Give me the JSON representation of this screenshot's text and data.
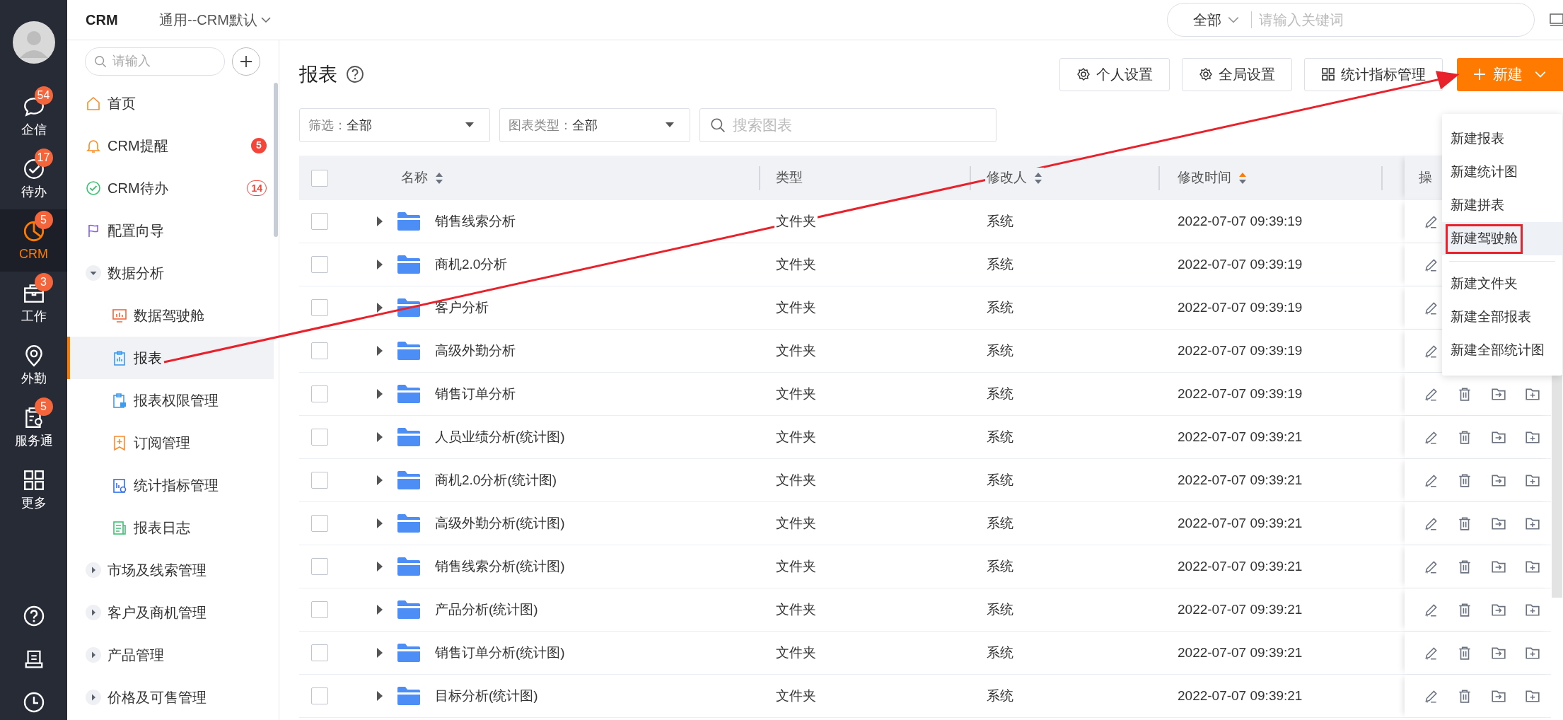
{
  "rail": {
    "items": [
      {
        "label": "企信",
        "badge": "54",
        "selected": false
      },
      {
        "label": "待办",
        "badge": "17",
        "selected": false
      },
      {
        "label": "CRM",
        "badge": "5",
        "selected": true
      },
      {
        "label": "工作",
        "badge": "3",
        "selected": false
      },
      {
        "label": "外勤",
        "selected": false
      },
      {
        "label": "服务通",
        "badge": "5",
        "selected": false
      },
      {
        "label": "更多",
        "selected": false
      }
    ]
  },
  "topbar": {
    "app": "CRM",
    "view": "通用--CRM默认",
    "scope": "全部",
    "search_placeholder": "请输入关键词"
  },
  "sidebar": {
    "search_placeholder": "请输入",
    "items": [
      {
        "label": "首页",
        "selected": false
      },
      {
        "label": "CRM提醒",
        "badge": "5",
        "outlined": false,
        "selected": false
      },
      {
        "label": "CRM待办",
        "badge": "14",
        "outlined": true,
        "selected": false
      },
      {
        "label": "配置向导",
        "selected": false
      },
      {
        "label": "数据分析",
        "expanded": true,
        "selected": false,
        "children": [
          {
            "label": "数据驾驶舱",
            "selected": false
          },
          {
            "label": "报表",
            "selected": true
          },
          {
            "label": "报表权限管理",
            "selected": false
          },
          {
            "label": "订阅管理",
            "selected": false
          },
          {
            "label": "统计指标管理",
            "selected": false
          },
          {
            "label": "报表日志",
            "selected": false
          }
        ]
      },
      {
        "label": "市场及线索管理",
        "expanded": false,
        "selected": false
      },
      {
        "label": "客户及商机管理",
        "expanded": false,
        "selected": false
      },
      {
        "label": "产品管理",
        "expanded": false,
        "selected": false
      },
      {
        "label": "价格及可售管理",
        "expanded": false,
        "selected": false
      }
    ]
  },
  "page": {
    "title": "报表",
    "buttons": [
      "个人设置",
      "全局设置",
      "统计指标管理"
    ],
    "new_button": "新建",
    "filters": [
      {
        "label": "筛选：",
        "value": "全部"
      },
      {
        "label": "图表类型：",
        "value": "全部"
      }
    ],
    "search_placeholder": "搜索图表"
  },
  "table": {
    "select_all": false,
    "columns": [
      {
        "label": "名称",
        "sorted": false
      },
      {
        "label": "类型"
      },
      {
        "label": "修改人",
        "sorted": false
      },
      {
        "label": "修改时间",
        "sorted": true
      },
      {
        "label": "操"
      }
    ],
    "rows": [
      {
        "checked": false,
        "expanded": false,
        "name": "销售线索分析",
        "type": "文件夹",
        "modifier": "系统",
        "time": "2022-07-07 09:39:19"
      },
      {
        "checked": false,
        "expanded": false,
        "name": "商机2.0分析",
        "type": "文件夹",
        "modifier": "系统",
        "time": "2022-07-07 09:39:19"
      },
      {
        "checked": false,
        "expanded": false,
        "name": "客户分析",
        "type": "文件夹",
        "modifier": "系统",
        "time": "2022-07-07 09:39:19"
      },
      {
        "checked": false,
        "expanded": false,
        "name": "高级外勤分析",
        "type": "文件夹",
        "modifier": "系统",
        "time": "2022-07-07 09:39:19"
      },
      {
        "checked": false,
        "expanded": false,
        "name": "销售订单分析",
        "type": "文件夹",
        "modifier": "系统",
        "time": "2022-07-07 09:39:19"
      },
      {
        "checked": false,
        "expanded": false,
        "name": "人员业绩分析(统计图)",
        "type": "文件夹",
        "modifier": "系统",
        "time": "2022-07-07 09:39:21"
      },
      {
        "checked": false,
        "expanded": false,
        "name": "商机2.0分析(统计图)",
        "type": "文件夹",
        "modifier": "系统",
        "time": "2022-07-07 09:39:21"
      },
      {
        "checked": false,
        "expanded": false,
        "name": "高级外勤分析(统计图)",
        "type": "文件夹",
        "modifier": "系统",
        "time": "2022-07-07 09:39:21"
      },
      {
        "checked": false,
        "expanded": false,
        "name": "销售线索分析(统计图)",
        "type": "文件夹",
        "modifier": "系统",
        "time": "2022-07-07 09:39:21"
      },
      {
        "checked": false,
        "expanded": false,
        "name": "产品分析(统计图)",
        "type": "文件夹",
        "modifier": "系统",
        "time": "2022-07-07 09:39:21"
      },
      {
        "checked": false,
        "expanded": false,
        "name": "销售订单分析(统计图)",
        "type": "文件夹",
        "modifier": "系统",
        "time": "2022-07-07 09:39:21"
      },
      {
        "checked": false,
        "expanded": false,
        "name": "目标分析(统计图)",
        "type": "文件夹",
        "modifier": "系统",
        "time": "2022-07-07 09:39:21"
      }
    ]
  },
  "new_menu": {
    "groups": [
      [
        {
          "label": "新建报表",
          "highlighted": false
        },
        {
          "label": "新建统计图",
          "highlighted": false
        },
        {
          "label": "新建拼表",
          "highlighted": false
        },
        {
          "label": "新建驾驶舱",
          "highlighted": true
        }
      ],
      [
        {
          "label": "新建文件夹",
          "highlighted": false
        },
        {
          "label": "新建全部报表",
          "highlighted": false
        },
        {
          "label": "新建全部统计图",
          "highlighted": false
        }
      ]
    ]
  },
  "annotation": {
    "arrow": true
  }
}
